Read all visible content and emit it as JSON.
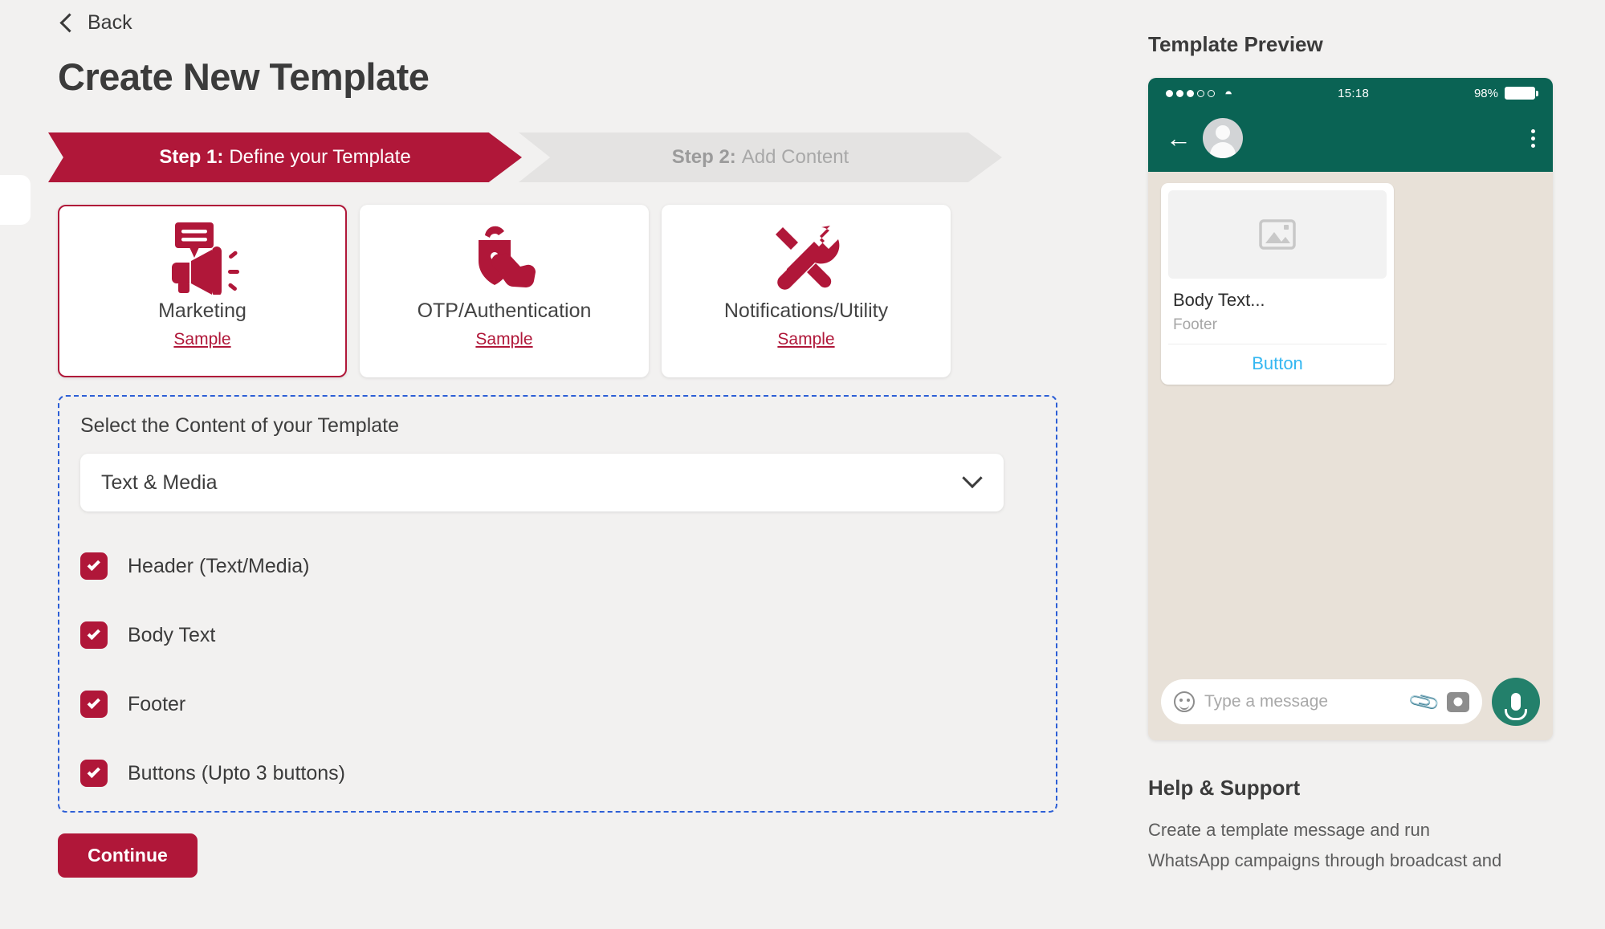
{
  "nav": {
    "back_label": "Back",
    "back_icon": "chevron-left-icon"
  },
  "header": {
    "title": "Create New Template"
  },
  "steps": [
    {
      "number": "Step 1:",
      "label": "Define your Template",
      "active": true
    },
    {
      "number": "Step 2:",
      "label": "Add Content",
      "active": false
    }
  ],
  "category_cards": [
    {
      "title": "Marketing",
      "sample_label": "Sample",
      "icon": "megaphone-icon",
      "selected": true
    },
    {
      "title": "OTP/Authentication",
      "sample_label": "Sample",
      "icon": "unlocked-padlock-hand-icon",
      "selected": false
    },
    {
      "title": "Notifications/Utility",
      "sample_label": "Sample",
      "icon": "wrench-screwdriver-icon",
      "selected": false
    }
  ],
  "content_panel": {
    "heading": "Select the Content of your Template",
    "select": {
      "value": "Text & Media",
      "chevron_icon": "chevron-down-icon"
    },
    "options": [
      {
        "label": "Header (Text/Media)",
        "checked": true
      },
      {
        "label": "Body Text",
        "checked": true
      },
      {
        "label": "Footer",
        "checked": true
      },
      {
        "label": "Buttons (Upto 3 buttons)",
        "checked": true
      }
    ]
  },
  "continue_button": {
    "label": "Continue"
  },
  "preview": {
    "title": "Template Preview",
    "status_bar": {
      "signal": "●●●○○",
      "wifi_icon": "wifi-icon",
      "time": "15:18",
      "battery_pct": "98%"
    },
    "chat_header": {
      "back_icon": "arrow-left-icon",
      "avatar_icon": "avatar-icon",
      "menu_icon": "kebab-menu-icon"
    },
    "bubble": {
      "media_icon": "image-placeholder-icon",
      "body": "Body Text...",
      "footer": "Footer",
      "button": "Button"
    },
    "input_bar": {
      "emoji_icon": "emoji-icon",
      "placeholder": "Type a message",
      "attach_icon": "paperclip-icon",
      "camera_icon": "camera-icon",
      "mic_icon": "microphone-icon"
    }
  },
  "help": {
    "title": "Help & Support",
    "line1": "Create a template message and run",
    "line2": "WhatsApp campaigns through broadcast and"
  },
  "colors": {
    "accent": "#b01739",
    "whatsapp_green": "#0a6354",
    "chat_bg": "#e8e1d8",
    "link_blue": "#34b7f1",
    "dashed_border": "#2d5fd6",
    "page_bg": "#f2f1f0"
  }
}
